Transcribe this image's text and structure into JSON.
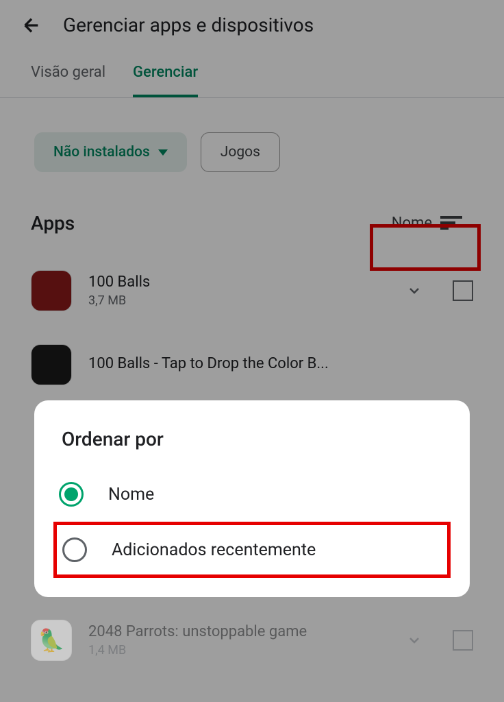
{
  "header": {
    "title": "Gerenciar apps e dispositivos"
  },
  "tabs": {
    "overview": "Visão geral",
    "manage": "Gerenciar"
  },
  "filters": {
    "not_installed": "Não instalados",
    "games": "Jogos"
  },
  "section": {
    "title": "Apps",
    "sort_label": "Nome"
  },
  "apps": [
    {
      "name": "100 Balls",
      "size": "3,7 MB"
    },
    {
      "name": "100 Balls - Tap to Drop the Color B...",
      "size": ""
    },
    {
      "name": "2048 Parrots: unstoppable game",
      "size": "1,4 MB"
    }
  ],
  "dialog": {
    "title": "Ordenar por",
    "options": {
      "name": "Nome",
      "recent": "Adicionados recentemente"
    }
  }
}
